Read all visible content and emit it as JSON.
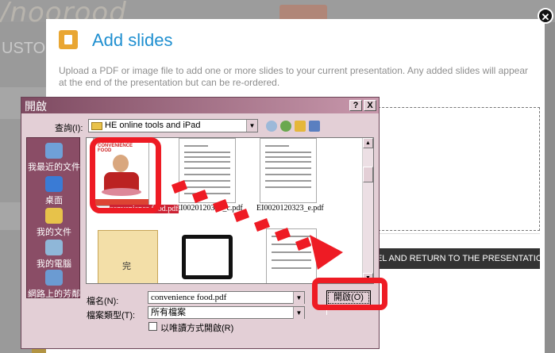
{
  "background": {
    "logo_text": "/noorood",
    "left_text": "USTO"
  },
  "dialog": {
    "title": "Add slides",
    "description": "Upload a PDF or image file to add one or more slides to your current presentation. Any added slides will appear at the end of the presentation but can be re-ordered.",
    "cancel_button": "CEL AND RETURN TO THE PRESENTATIO",
    "close_glyph": "✕"
  },
  "file_dialog": {
    "title": "開啟",
    "help_btn": "?",
    "close_btn": "X",
    "look_in_label": "查詢(I):",
    "look_in_value": "HE online tools and iPad",
    "places": [
      {
        "label": "我最近的文件",
        "color": "#6fa0d8"
      },
      {
        "label": "桌面",
        "color": "#3a7bd5"
      },
      {
        "label": "我的文件",
        "color": "#e7c24a"
      },
      {
        "label": "我的電腦",
        "color": "#8fb7d8"
      },
      {
        "label": "網路上的芳鄰",
        "color": "#6b9bd2"
      }
    ],
    "files": [
      {
        "label": "convenience food.pdf",
        "thumb_title": "CONVENIENCE FOOD",
        "thumb_subtitle": "快速食物"
      },
      {
        "label": "EI0020120323_c.pdf"
      },
      {
        "label": "EI0020120323_e.pdf"
      },
      {
        "label": "完",
        "kind": "folder"
      },
      {
        "label": "",
        "kind": "tablet"
      },
      {
        "label": "",
        "kind": "doc"
      }
    ],
    "filename_label": "檔名(N):",
    "filename_value": "convenience food.pdf",
    "filetype_label": "檔案類型(T):",
    "filetype_value": "所有檔案",
    "readonly_label": "以唯讀方式開啟(R)",
    "open_button": "開啟(O)"
  },
  "highlight_color": "#ee1b24"
}
